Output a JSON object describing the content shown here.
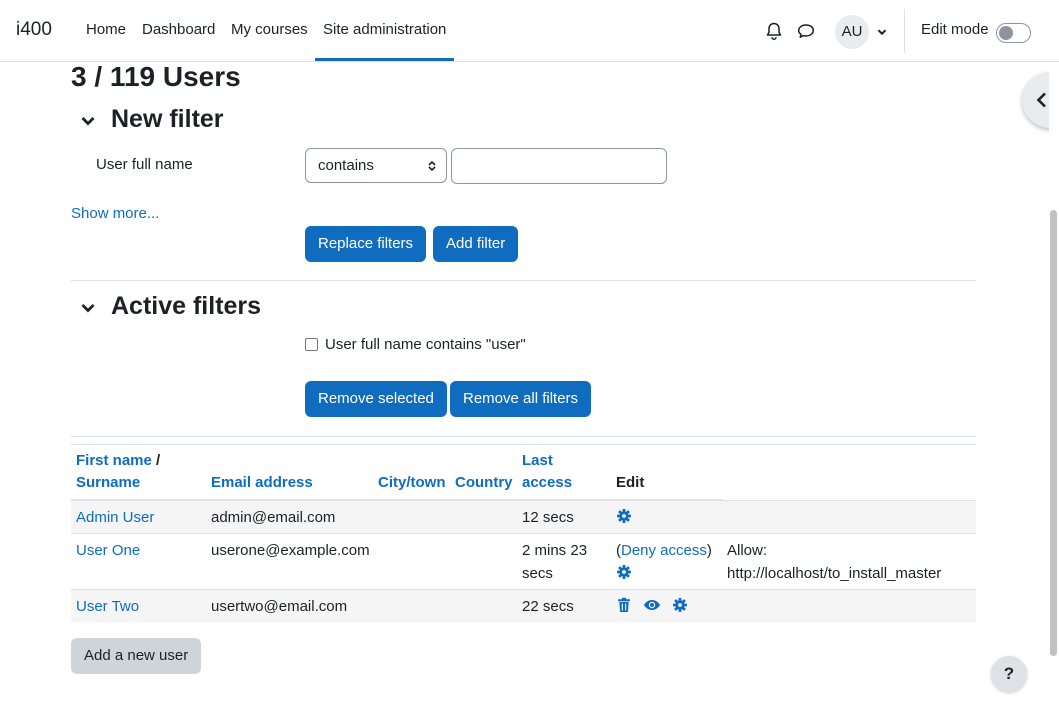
{
  "nav": {
    "brand": "i400",
    "items": [
      "Home",
      "Dashboard",
      "My courses",
      "Site administration"
    ],
    "avatar_initials": "AU",
    "edit_mode_label": "Edit mode"
  },
  "page": {
    "heading": "3 / 119 Users"
  },
  "new_filter": {
    "heading": "New filter",
    "field_label": "User full name",
    "operator_value": "contains",
    "text_value": "",
    "show_more": "Show more...",
    "replace_button": "Replace filters",
    "add_button": "Add filter"
  },
  "active_filters": {
    "heading": "Active filters",
    "items": [
      {
        "label": "User full name contains \"user\"",
        "checked": false
      }
    ],
    "remove_selected": "Remove selected",
    "remove_all": "Remove all filters"
  },
  "table": {
    "headers": {
      "firstname": "First name",
      "slash": "/",
      "surname": "Surname",
      "email": "Email address",
      "city": "City/town",
      "country": "Country",
      "last": "Last",
      "access": "access",
      "edit": "Edit"
    },
    "rows": [
      {
        "name": "Admin User",
        "email": "admin@email.com",
        "access": "12 secs"
      },
      {
        "name": "User One",
        "email": "userone@example.com",
        "access_line1": "2 mins 23",
        "access_line2": "secs",
        "paren_open": "(",
        "deny": "Deny access",
        "paren_close": ")",
        "note_line1": "Allow:",
        "note_line2": "http://localhost/to_install_master"
      },
      {
        "name": "User Two",
        "email": "usertwo@email.com",
        "access": "22 secs"
      }
    ]
  },
  "add_user_button": "Add a new user",
  "help_label": "?",
  "colors": {
    "primary": "#0f6cbf",
    "text": "#1d2125",
    "secondary": "#ced4da"
  }
}
